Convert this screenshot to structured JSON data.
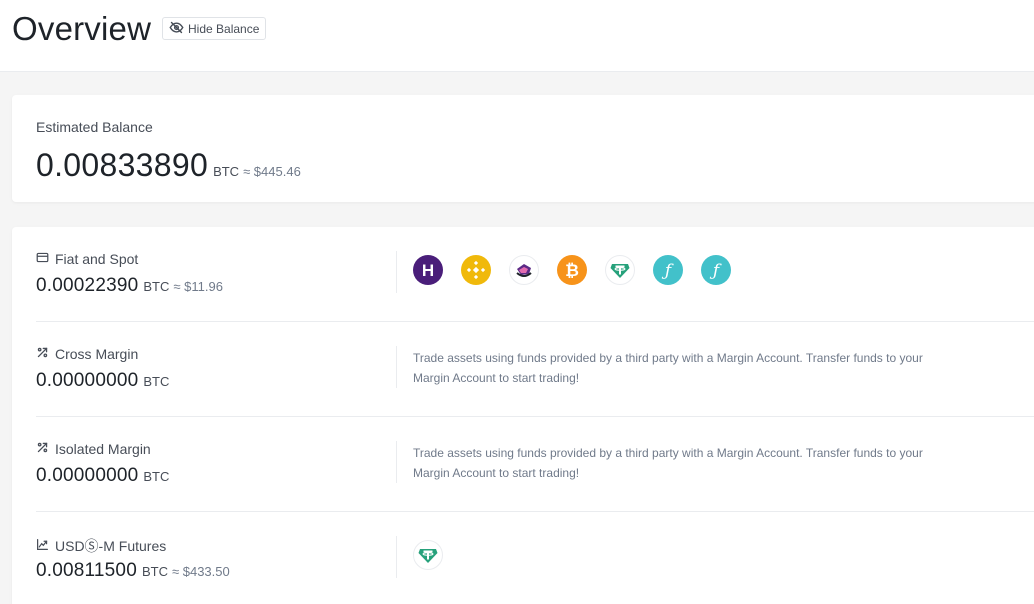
{
  "header": {
    "title": "Overview",
    "hide_balance_label": "Hide Balance"
  },
  "estimated": {
    "label": "Estimated Balance",
    "amount": "0.00833890",
    "unit": "BTC",
    "fiat": "≈ $445.46"
  },
  "accounts": [
    {
      "name": "Fiat and Spot",
      "icon": "wallet-icon",
      "amount": "0.00022390",
      "unit": "BTC",
      "fiat": "≈ $11.96",
      "coins": [
        "hive-coin-icon",
        "bnb-coin-icon",
        "token-coin-icon",
        "bitcoin-coin-icon",
        "tether-coin-icon",
        "filecoin-coin-icon",
        "filecoin-coin-icon"
      ]
    },
    {
      "name": "Cross Margin",
      "icon": "margin-icon",
      "amount": "0.00000000",
      "unit": "BTC",
      "fiat": "",
      "description": "Trade assets using funds provided by a third party with a Margin Account. Transfer funds to your Margin Account to start trading!"
    },
    {
      "name": "Isolated Margin",
      "icon": "margin-icon",
      "amount": "0.00000000",
      "unit": "BTC",
      "fiat": "",
      "description": "Trade assets using funds provided by a third party with a Margin Account. Transfer funds to your Margin Account to start trading!"
    },
    {
      "name": "USDⓈ-M Futures",
      "icon": "futures-icon",
      "amount": "0.00811500",
      "unit": "BTC",
      "fiat": "≈ $433.50",
      "coins": [
        "tether-coin-icon"
      ]
    }
  ],
  "colors": {
    "hive": "#4a1e7a",
    "bnb": "#f0b90b",
    "bitcoin": "#f7931a",
    "tether": "#26a17b",
    "filecoin": "#42c1ca"
  }
}
